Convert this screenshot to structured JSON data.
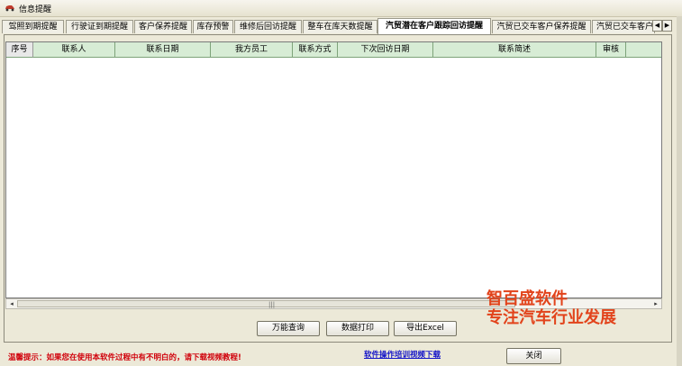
{
  "window": {
    "title": "信息提醒"
  },
  "tabs": [
    {
      "label": "驾照到期提醒",
      "active": false
    },
    {
      "label": "行驶证到期提醒",
      "active": false
    },
    {
      "label": "客户保养提醒",
      "active": false
    },
    {
      "label": "库存预警",
      "active": false
    },
    {
      "label": "维修后回访提醒",
      "active": false
    },
    {
      "label": "整车在库天数提醒",
      "active": false
    },
    {
      "label": "汽贸潜在客户跟踪回访提醒",
      "active": true
    },
    {
      "label": "汽贸已交车客户保养提醒",
      "active": false
    },
    {
      "label": "汽贸已交车客户",
      "active": false
    }
  ],
  "grid": {
    "columns": [
      "序号",
      "联系人",
      "联系日期",
      "我方员工",
      "联系方式",
      "下次回访日期",
      "联系简述",
      "审核",
      ""
    ],
    "rows": []
  },
  "scrollbar": {
    "grip": "|||"
  },
  "buttons": {
    "search": "万能查询",
    "print": "数据打印",
    "export": "导出Excel",
    "close": "关闭"
  },
  "promo": {
    "line1": "智百盛软件",
    "line2": "专注汽车行业发展"
  },
  "footer": {
    "tip": "温馨提示：如果您在使用本软件过程中有不明白的，请下载视频教程!",
    "video_link": "软件操作培训视频下载"
  },
  "colors": {
    "header_green": "#d7ecd5",
    "promo_orange": "#e2431b",
    "tip_red": "#d0000a",
    "link_blue": "#1414c8"
  }
}
